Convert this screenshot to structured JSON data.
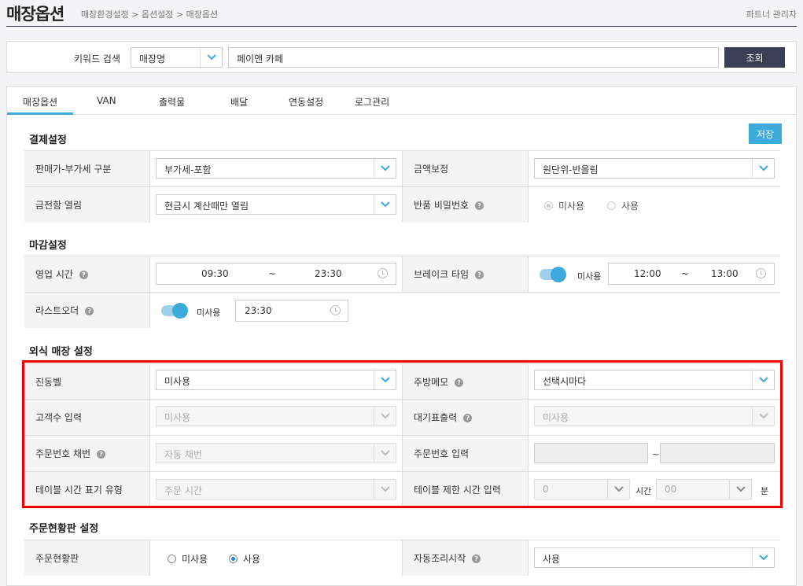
{
  "header": {
    "title": "매장옵션",
    "breadcrumb": "매장환경설정 > 옵션설정 > 매장옵션",
    "partner": "파트너 관리자"
  },
  "search": {
    "label": "키워드 검색",
    "type_value": "매장명",
    "keyword_value": "페이앤 카페",
    "button": "조회"
  },
  "tabs": [
    "매장옵션",
    "VAN",
    "출력물",
    "배달",
    "연동설정",
    "로그관리"
  ],
  "save_label": "저장",
  "payment": {
    "title": "결제설정",
    "tax_label": "판매가-부가세 구분",
    "tax_value": "부가세-포함",
    "rounding_label": "금액보정",
    "rounding_value": "원단위-반올림",
    "drawer_label": "금전함 열림",
    "drawer_value": "현금시 계산때만 열림",
    "refund_pw_label": "반품 비밀번호",
    "refund_options": [
      "미사용",
      "사용"
    ]
  },
  "closing": {
    "title": "마감설정",
    "hours_label": "영업 시간",
    "open_time": "09:30",
    "close_time": "23:30",
    "tilde": "~",
    "break_label": "브레이크 타임",
    "break_toggle_text": "미사용",
    "break_start": "12:00",
    "break_end": "13:00",
    "last_order_label": "라스트오더",
    "last_order_toggle_text": "미사용",
    "last_order_time": "23:30"
  },
  "dinein": {
    "title": "외식 매장 설정",
    "bell_label": "진동벨",
    "bell_value": "미사용",
    "kitchen_memo_label": "주방메모",
    "kitchen_memo_value": "선택시마다",
    "guest_count_label": "고객수 입력",
    "guest_count_value": "미사용",
    "waiting_label": "대기표출력",
    "waiting_value": "미사용",
    "order_num_label": "주문번호 채번",
    "order_num_value": "자동 채번",
    "order_input_label": "주문번호 입력",
    "order_tilde": "~",
    "table_time_label": "테이블 시간 표기 유형",
    "table_time_value": "주문 시간",
    "table_limit_label": "테이블 제한 시간 입력",
    "limit_hour": "0",
    "hour_unit": "시간",
    "limit_min": "00",
    "min_unit": "분"
  },
  "order_board": {
    "title": "주문현황판 설정",
    "board_label": "주문현황판",
    "board_options": [
      "미사용",
      "사용"
    ],
    "auto_cook_label": "자동조리시작",
    "auto_cook_value": "사용"
  }
}
